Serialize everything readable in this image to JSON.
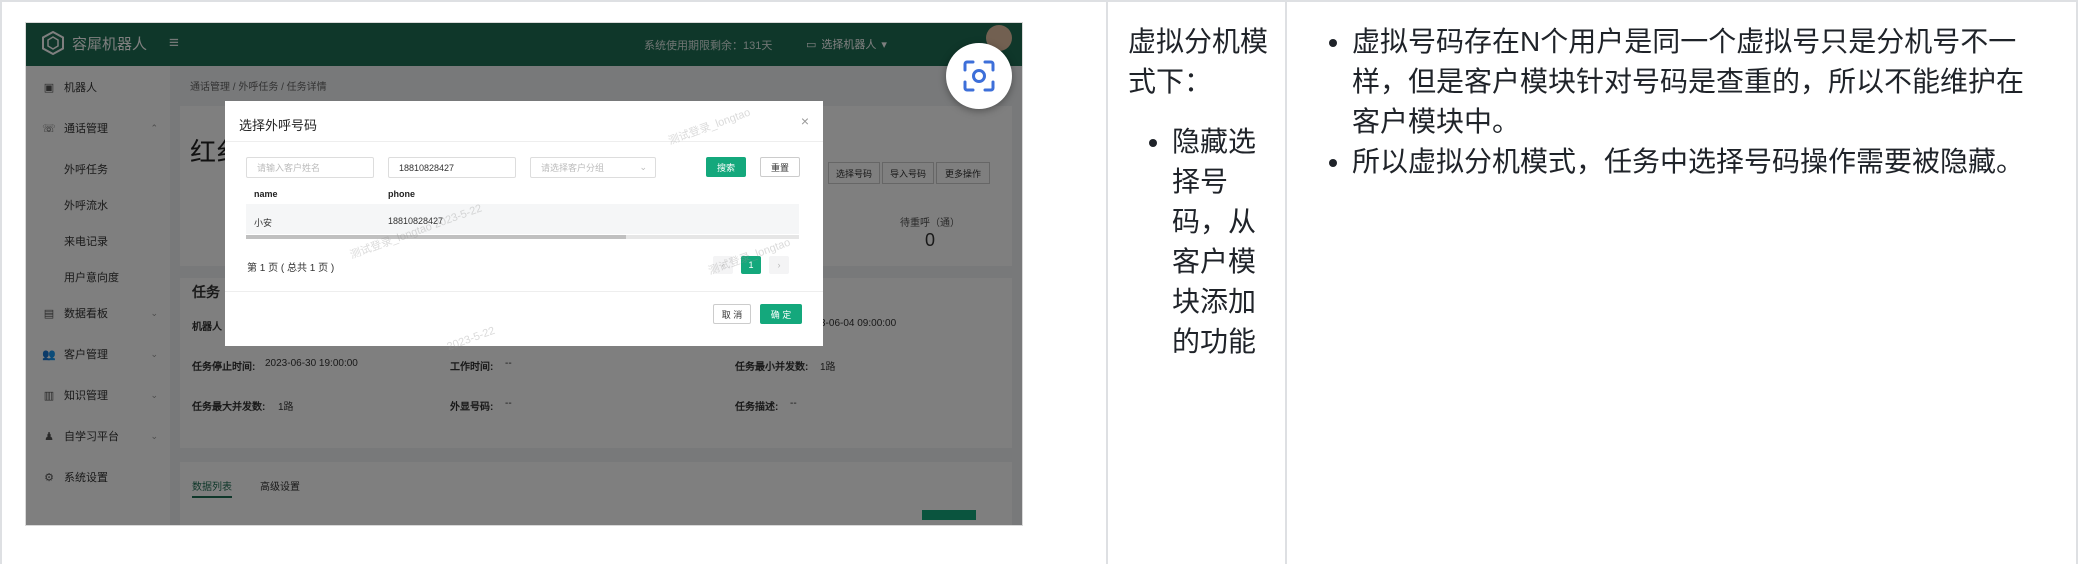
{
  "screenshot": {
    "app_name": "容犀机器人",
    "expiry_text": "系统使用期限剩余：131天",
    "robot_select": "选择机器人",
    "sidebar": [
      {
        "label": "机器人",
        "icon": "robot-icon",
        "indent": false
      },
      {
        "label": "通话管理",
        "icon": "phone-icon",
        "indent": false
      },
      {
        "label": "外呼任务",
        "icon": "",
        "indent": true
      },
      {
        "label": "外呼流水",
        "icon": "",
        "indent": true
      },
      {
        "label": "来电记录",
        "icon": "",
        "indent": true
      },
      {
        "label": "用户意向度",
        "icon": "",
        "indent": true
      },
      {
        "label": "数据看板",
        "icon": "chart-icon",
        "indent": false
      },
      {
        "label": "客户管理",
        "icon": "users-icon",
        "indent": false
      },
      {
        "label": "知识管理",
        "icon": "book-icon",
        "indent": false
      },
      {
        "label": "自学习平台",
        "icon": "learn-icon",
        "indent": false
      },
      {
        "label": "系统设置",
        "icon": "settings-icon",
        "indent": false
      }
    ],
    "breadcrumb": "通话管理 / 外呼任务 / 任务详情",
    "task_title": "红纟",
    "ops": [
      "选择号码",
      "导入号码",
      "更多操作"
    ],
    "stat_label": "待重呼（通）",
    "stat_value": "0",
    "section_title": "任务",
    "info_robot": "机器人",
    "info_date_tail": "3-06-04 09:00:00",
    "info_stop_label": "任务停止时间:",
    "info_stop_value": "2023-06-30 19:00:00",
    "info_work_label": "工作时间:",
    "info_work_value": "--",
    "info_min_label": "任务最小并发数:",
    "info_min_value": "1路",
    "info_max_label": "任务最大并发数:",
    "info_max_value": "1路",
    "info_ext_label": "外显号码:",
    "info_ext_value": "--",
    "info_desc_label": "任务描述:",
    "info_desc_value": "--",
    "tab_list": "数据列表",
    "tab_advanced": "高级设置",
    "modal": {
      "title": "选择外呼号码",
      "name_placeholder": "请输入客户姓名",
      "phone_value": "18810828427",
      "group_placeholder": "请选择客户分组",
      "search": "搜索",
      "reset": "重置",
      "col_name": "name",
      "col_phone": "phone",
      "row_name": "小安",
      "row_phone": "18810828427",
      "pager_text": "第 1 页 ( 总共 1 页 )",
      "page_current": "1",
      "cancel": "取 消",
      "confirm": "确 定"
    },
    "watermark_user": "测试登录_longtao",
    "watermark_date": "2023-5-22",
    "accent_color": "#1f6f55",
    "button_color": "#14a87c"
  },
  "col2": {
    "heading": "虚拟分机模式下：",
    "bullets": [
      "隐藏选择号码，从客户模块添加的功能"
    ]
  },
  "col3": {
    "bullets": [
      "虚拟号码存在N个用户是同一个虚拟号只是分机号不一样，但是客户模块针对号码是查重的，所以不能维护在客户模块中。",
      "所以虚拟分机模式，任务中选择号码操作需要被隐藏。"
    ]
  }
}
